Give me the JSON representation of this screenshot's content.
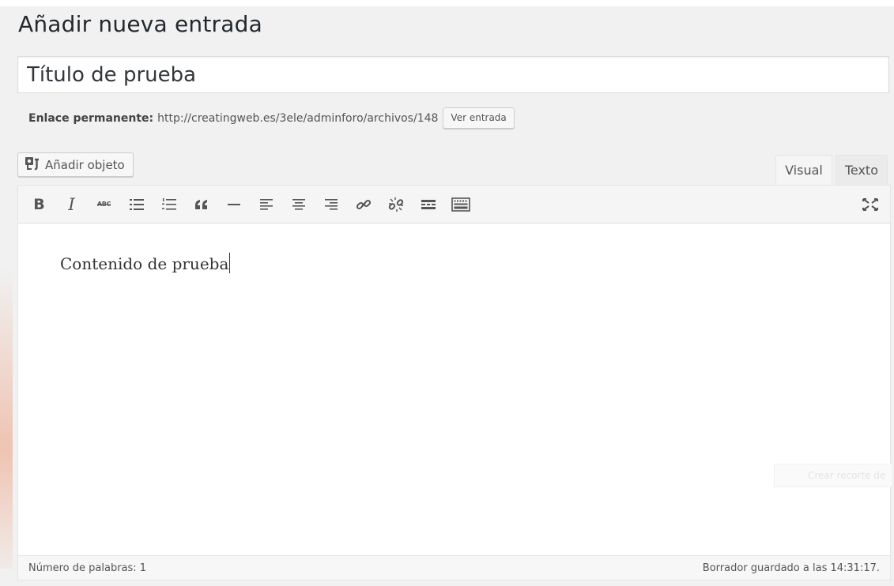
{
  "page": {
    "title": "Añadir nueva entrada"
  },
  "post": {
    "title_value": "Título de prueba"
  },
  "permalink": {
    "label": "Enlace permanente:",
    "url": "http://creatingweb.es/3ele/adminforo/archivos/148",
    "view_button": "Ver entrada"
  },
  "media": {
    "add_button": "Añadir objeto",
    "icon": "add-media-icon"
  },
  "editor_tabs": {
    "visual": "Visual",
    "text": "Texto",
    "active": "Visual"
  },
  "toolbar": {
    "buttons": [
      "bold",
      "italic",
      "strikethrough",
      "bulleted-list",
      "numbered-list",
      "blockquote",
      "horizontal-line",
      "align-left",
      "align-center",
      "align-right",
      "insert-link",
      "remove-link",
      "read-more",
      "toolbar-toggle",
      "fullscreen"
    ],
    "bold_glyph": "B",
    "italic_glyph": "I",
    "strike_glyph": "ABC"
  },
  "content": {
    "text": "Contenido de prueba",
    "ghost_button": "Crear recorte de"
  },
  "status": {
    "word_count": "Número de palabras: 1",
    "draft_saved": "Borrador guardado a las 14:31:17."
  },
  "colors": {
    "background": "#f1f1f1",
    "editor_bg": "#ffffff",
    "toolbar_bg": "#f5f5f5",
    "text": "#23282d",
    "icon": "#555555",
    "accent": "#ea6e3c"
  }
}
